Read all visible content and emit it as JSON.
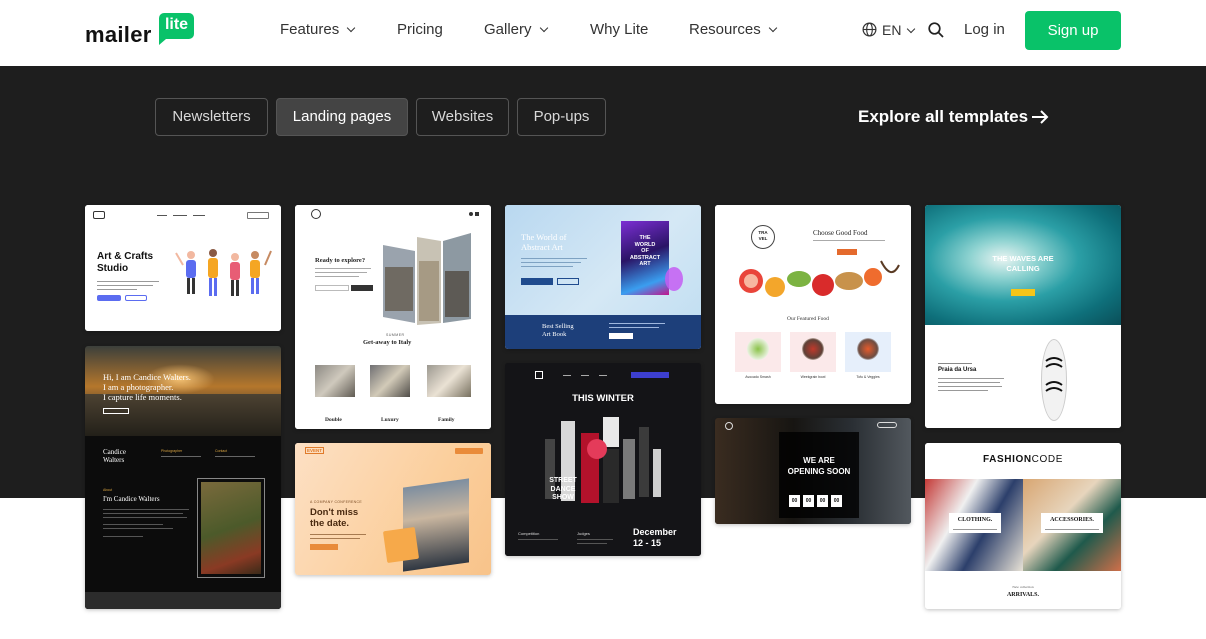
{
  "nav": {
    "logo_text": "mailer",
    "logo_badge": "lite",
    "items": [
      {
        "label": "Features",
        "has_dropdown": true
      },
      {
        "label": "Pricing",
        "has_dropdown": false
      },
      {
        "label": "Gallery",
        "has_dropdown": true
      },
      {
        "label": "Why Lite",
        "has_dropdown": false
      },
      {
        "label": "Resources",
        "has_dropdown": true
      }
    ],
    "language": "EN",
    "login": "Log in",
    "signup": "Sign up"
  },
  "colors": {
    "brand_green": "#09c269",
    "dark_bg": "#1e1e1e"
  },
  "filter_tabs": [
    {
      "label": "Newsletters",
      "active": false
    },
    {
      "label": "Landing pages",
      "active": true
    },
    {
      "label": "Websites",
      "active": false
    },
    {
      "label": "Pop-ups",
      "active": false
    }
  ],
  "explore_link": "Explore all templates",
  "cards": {
    "art_crafts": {
      "title_line1": "Art & Crafts",
      "title_line2": "Studio"
    },
    "candice": {
      "hero_line1": "Hi, I am Candice Walters.",
      "hero_line2": "I am a photographer.",
      "hero_line3": "I capture life moments.",
      "name_line1": "Candice",
      "name_line2": "Walters",
      "col1": "Photographer",
      "col2": "Contact",
      "about_label": "About",
      "about_title": "I'm Candice Walters"
    },
    "italy": {
      "hero_title": "Ready to explore?",
      "eyebrow": "SUMMER",
      "subtitle": "Get-away to Italy",
      "options": [
        "Double",
        "Luxury",
        "Family"
      ]
    },
    "event": {
      "logo": "EVENT",
      "eyebrow": "A COMPANY CONFERENCE",
      "title_line1": "Don't miss",
      "title_line2": "the date."
    },
    "abstract_art": {
      "title_line1": "The World of",
      "title_line2": "Abstract Art",
      "book_line1": "THE",
      "book_line2": "WORLD",
      "book_line3": "OF",
      "book_line4": "ABSTRACT",
      "book_line5": "ART",
      "footer_line1": "Best Selling",
      "footer_line2": "Art Book"
    },
    "street_dance": {
      "title": "THIS WINTER",
      "show_line1": "STREET",
      "show_line2": "DANCE",
      "show_line3": "SHOW",
      "date_line1": "December",
      "date_line2": "12 - 15",
      "label1": "Competition",
      "label2": "Judges"
    },
    "travel_food": {
      "logo_line1": "TRA",
      "logo_line2": "VEL",
      "title": "Choose Good Food",
      "section": "Our Featured Food",
      "items": [
        "Avocado Smash",
        "Weekgrain bowl",
        "Tofu & Veggies"
      ]
    },
    "opening": {
      "line1": "WE ARE",
      "line2": "OPENING SOON",
      "countdown": [
        "00",
        "00",
        "00",
        "00"
      ]
    },
    "waves": {
      "title_line1": "THE WAVES ARE",
      "title_line2": "CALLING",
      "subtitle": "Praia da Ursa"
    },
    "fashion": {
      "brand_part1": "FASHION",
      "brand_part2": "CODE",
      "cat1": "CLOTHING.",
      "cat2": "ACCESSORIES.",
      "small": "New collection",
      "arrivals": "ARRIVALS."
    }
  }
}
